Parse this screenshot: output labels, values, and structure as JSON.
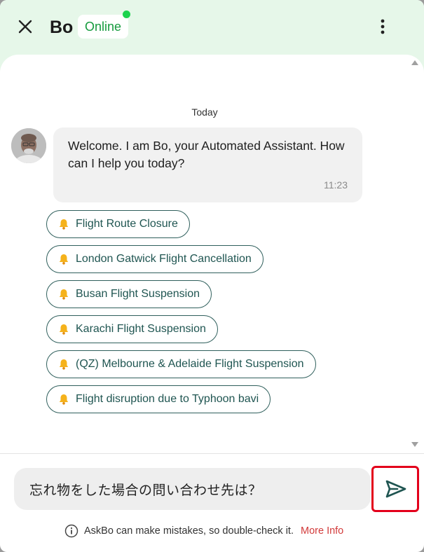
{
  "header": {
    "agent_name": "Bo",
    "status": "Online",
    "close_icon": "close-icon",
    "menu_icon": "more-vertical-icon"
  },
  "colors": {
    "header_bg": "#e6f7e9",
    "online_text": "#159a3d",
    "online_dot": "#1cd34d",
    "chip_border": "#2f5f5c",
    "send_icon": "#1f5551",
    "highlight": "#e3001b",
    "link": "#d23a3a"
  },
  "chat": {
    "date_separator": "Today",
    "messages": [
      {
        "sender": "Bo",
        "avatar_icon": "avatar",
        "text": "Welcome. I am Bo, your Automated Assistant. How can I help you today?",
        "time": "11:23"
      }
    ],
    "quick_replies": [
      {
        "icon": "bell-icon",
        "label": "Flight Route Closure"
      },
      {
        "icon": "bell-icon",
        "label": "London Gatwick Flight Cancellation"
      },
      {
        "icon": "bell-icon",
        "label": "Busan Flight Suspension"
      },
      {
        "icon": "bell-icon",
        "label": "Karachi Flight Suspension"
      },
      {
        "icon": "bell-icon",
        "label": "(QZ) Melbourne & Adelaide Flight Suspension"
      },
      {
        "icon": "bell-icon",
        "label": "Flight disruption due to Typhoon bavi"
      }
    ]
  },
  "composer": {
    "input_value": "忘れ物をした場合の問い合わせ先は？",
    "send_icon": "send-icon"
  },
  "footer": {
    "info_icon": "info-icon",
    "disclaimer": "AskBo can make mistakes, so double-check it.",
    "more_info_label": "More Info"
  }
}
